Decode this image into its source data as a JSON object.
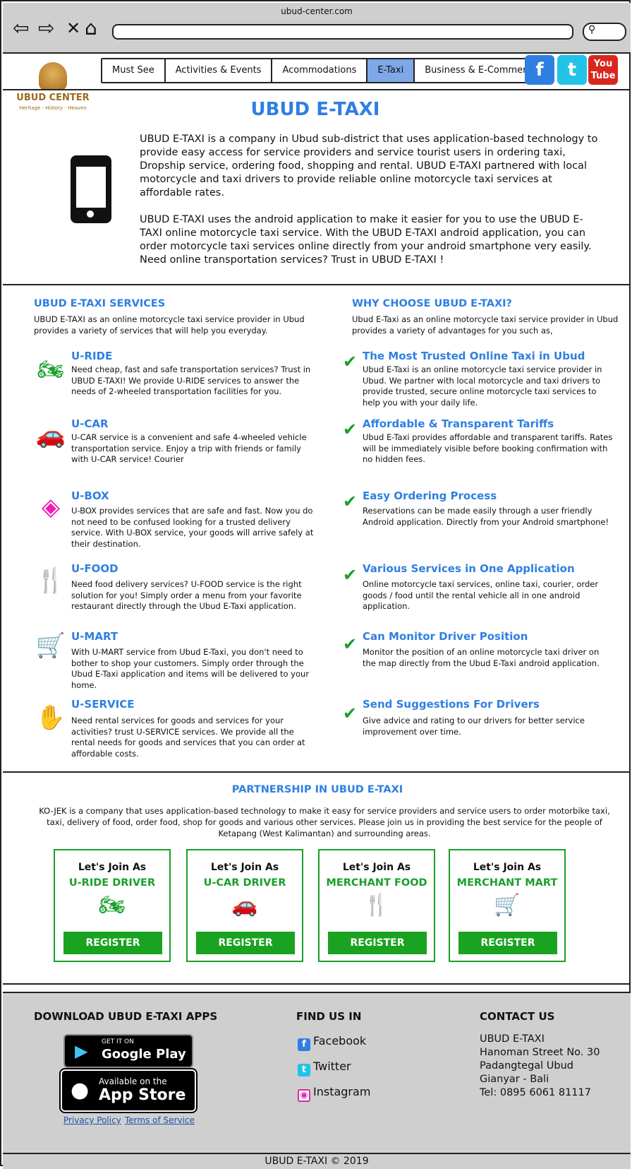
{
  "browser": {
    "url": "ubud-center.com"
  },
  "logo": {
    "name": "UBUD CENTER",
    "tagline": "Heritage - History - Heaven"
  },
  "menu": [
    "Must See",
    "Activities & Events",
    "Acommodations",
    "E-Taxi",
    "Business & E-Commerce"
  ],
  "social": {
    "facebook": "f",
    "twitter": "t",
    "youtube": "You Tube"
  },
  "intro": {
    "title": "UBUD E-TAXI",
    "p1": "UBUD E-TAXI is a company in Ubud sub-district that uses application-based technology to provide easy access for service providers and service tourist users in ordering taxi, Dropship service, ordering food, shopping and rental. UBUD E-TAXI partnered with local motorcycle and taxi drivers to provide reliable online motorcycle taxi services at affordable rates.",
    "p2": "UBUD E-TAXI uses the android application to make it easier for you to use the UBUD E-TAXI online motorcycle taxi service. With the UBUD E-TAXI android application, you can order motorcycle taxi services online directly from your android smartphone very easily. Need online transportation services? Trust in UBUD E-TAXI !"
  },
  "services": {
    "title": "UBUD E-TAXI SERVICES",
    "intro": "UBUD E-TAXI as an online motorcycle taxi service provider in Ubud provides a variety of services that will help you everyday.",
    "items": [
      {
        "title": "U-RIDE",
        "text": "Need cheap, fast and safe transportation services? Trust in UBUD E-TAXI! We provide U-RIDE services to answer the needs of 2-wheeled transportation facilities for you."
      },
      {
        "title": "U-CAR",
        "text": "U-CAR service is a convenient and safe 4-wheeled vehicle transportation service. Enjoy a trip with friends or family with U-CAR service! Courier"
      },
      {
        "title": "U-BOX",
        "text": "U-BOX provides services that are safe and fast. Now you do not need to be confused looking for a trusted delivery service. With U-BOX service, your goods will arrive safely at their destination."
      },
      {
        "title": "U-FOOD",
        "text": "Need food delivery services? U-FOOD service is the right solution for you! Simply order a menu from your favorite restaurant directly through the Ubud E-Taxi application."
      },
      {
        "title": "U-MART",
        "text": "With U-MART service from Ubud E-Taxi, you don't need to bother to shop your customers. Simply order through the Ubud E-Taxi application and items will be delivered to your home."
      },
      {
        "title": "U-SERVICE",
        "text": "Need rental services for goods and services for your activities? trust U-SERVICE services. We provide all the rental needs for goods and services that you can order at affordable costs."
      }
    ]
  },
  "why": {
    "title": "WHY CHOOSE UBUD E-TAXI?",
    "intro": "Ubud E-Taxi as an online motorcycle taxi service provider in Ubud provides a variety of advantages for you such as,",
    "items": [
      {
        "title": "The Most Trusted Online Taxi in Ubud",
        "text": "Ubud E-Taxi is an online motorcycle taxi service provider in Ubud. We partner with local motorcycle and taxi drivers to provide trusted, secure online motorcycle taxi services to help you with your daily life."
      },
      {
        "title": "Affordable & Transparent Tariffs",
        "text": "Ubud E-Taxi provides affordable and transparent tariffs. Rates will be immediately visible before booking confirmation with no hidden fees."
      },
      {
        "title": "Easy Ordering Process",
        "text": "Reservations can be made easily through a user friendly Android application. Directly from your Android smartphone!"
      },
      {
        "title": "Various Services in One Application",
        "text": "Online motorcycle taxi services, online taxi, courier, order goods / food until the rental vehicle all in one android application."
      },
      {
        "title": "Can Monitor Driver Position",
        "text": "Monitor the position of an online motorcycle taxi driver on the map directly from the Ubud E-Taxi android application."
      },
      {
        "title": "Send Suggestions For Drivers",
        "text": "Give advice and rating to our drivers for better service improvement over time."
      }
    ]
  },
  "partnership": {
    "title": "PARTNERSHIP IN UBUD E-TAXI",
    "text": "KO-JEK is a company that uses application-based technology to make it easy for service providers and service users to order motorbike taxi, taxi, delivery of food, order food, shop for goods and various other services. Please join us in providing the best service for the people of Ketapang (West Kalimantan) and surrounding areas.",
    "cards": [
      {
        "lead": "Let's Join As",
        "role": "U-RIDE DRIVER",
        "button": "REGISTER"
      },
      {
        "lead": "Let's Join As",
        "role": "U-CAR DRIVER",
        "button": "REGISTER"
      },
      {
        "lead": "Let's Join As",
        "role": "MERCHANT FOOD",
        "button": "REGISTER"
      },
      {
        "lead": "Let's Join As",
        "role": "MERCHANT MART",
        "button": "REGISTER"
      }
    ]
  },
  "footer": {
    "download_title": "DOWNLOAD UBUD E-TAXI APPS",
    "google_small": "GET IT ON",
    "google_big": "Google Play",
    "apple_small": "Available on the",
    "apple_big": "App Store",
    "privacy": "Privacy Policy",
    "terms": "Terms of Service",
    "find_title": "FIND US IN",
    "find": [
      "Facebook",
      "Twitter",
      "Instagram"
    ],
    "contact_title": "CONTACT US",
    "contact": [
      "UBUD E-TAXI",
      "Hanoman Street No. 30",
      "Padangtegal Ubud",
      "Gianyar - Bali",
      "Tel: 0895 6061 81117"
    ],
    "copyright": "UBUD E-TAXI © 2019"
  },
  "colors": {
    "accent": "#2f7fe2",
    "green": "#19a02a",
    "chrome": "#cfcfcf"
  }
}
